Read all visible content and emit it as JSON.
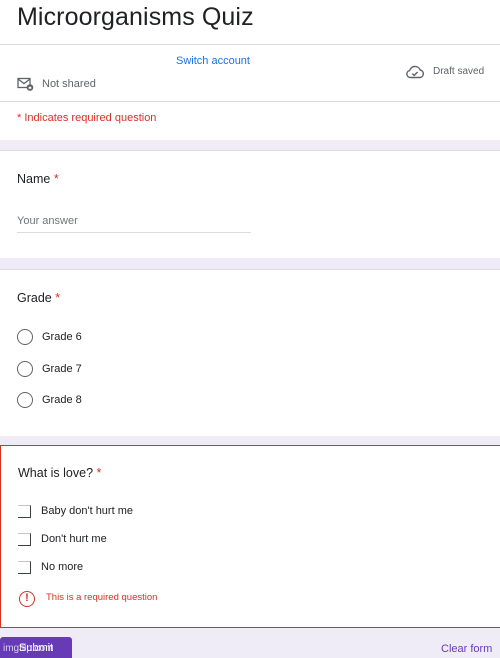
{
  "form": {
    "title": "Microorganisms Quiz",
    "switch_account": "Switch account",
    "not_shared": "Not shared",
    "draft_saved": "Draft saved",
    "required_note": "* Indicates required question"
  },
  "questions": [
    {
      "title": "Name",
      "required_marker": "*",
      "type": "short-answer",
      "placeholder": "Your answer"
    },
    {
      "title": "Grade",
      "required_marker": "*",
      "type": "multiple-choice",
      "options": [
        "Grade 6",
        "Grade 7",
        "Grade 8"
      ]
    },
    {
      "title": "What is love?",
      "required_marker": "*",
      "type": "checkboxes",
      "options": [
        "Baby don't hurt me",
        "Don't hurt me",
        "No more"
      ],
      "error": "This is a required question"
    }
  ],
  "actions": {
    "submit": "Submit",
    "clear_form": "Clear form"
  },
  "watermark": "imgflip.com",
  "colors": {
    "accent": "#673ab7",
    "error": "#d93025",
    "link": "#1a73e8",
    "background": "#efebf7"
  },
  "icons": {
    "not_shared": "mail-lock-icon",
    "draft_saved": "cloud-check-icon",
    "error": "exclamation-circle-icon"
  }
}
